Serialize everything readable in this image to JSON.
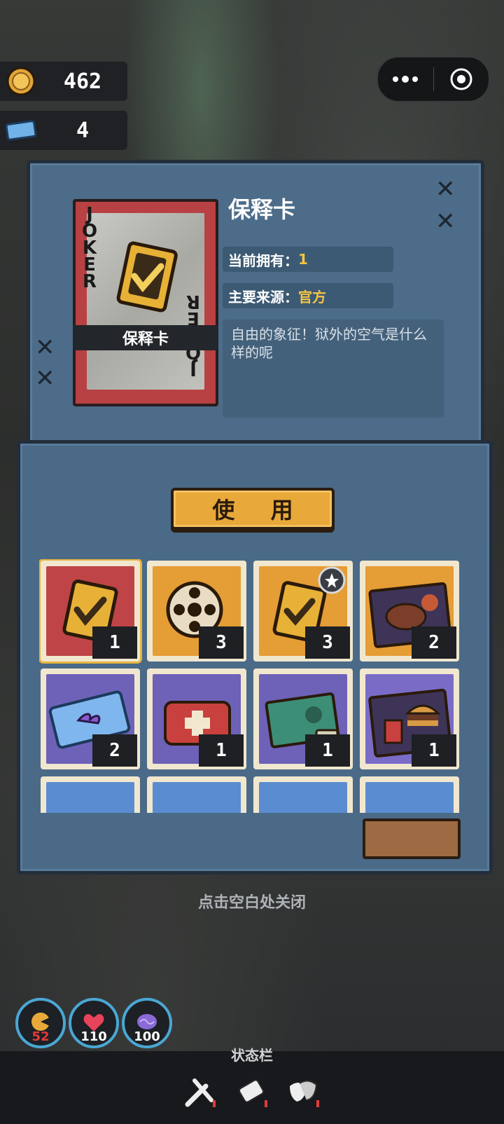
{
  "currencies": [
    {
      "icon": "coin-icon",
      "value": "462"
    },
    {
      "icon": "ticket-icon",
      "value": "4"
    }
  ],
  "capsule": {
    "menu_icon": "more-dots-icon",
    "close_icon": "target-icon"
  },
  "item": {
    "name": "保释卡",
    "card_title": "保释卡",
    "joker_text": "JOKER",
    "owned_label": "当前拥有：",
    "owned_value": "1",
    "source_label": "主要来源：",
    "source_value": "官方",
    "description": "自由的象征！狱外的空气是什么样的呢"
  },
  "use_button": "使 用",
  "inventory": [
    {
      "name": "bail-card",
      "color": "red",
      "count": "1",
      "selected": true
    },
    {
      "name": "film-reel",
      "color": "orange",
      "count": "3"
    },
    {
      "name": "bail-card-plus",
      "color": "orange",
      "count": "3"
    },
    {
      "name": "steak-meal",
      "color": "orange",
      "count": "2"
    },
    {
      "name": "toy-ticket",
      "color": "purple",
      "count": "2"
    },
    {
      "name": "first-aid-kit",
      "color": "purple",
      "count": "1"
    },
    {
      "name": "game-box",
      "color": "purple",
      "count": "1"
    },
    {
      "name": "burger-meal",
      "color": "purple",
      "count": "1"
    },
    {
      "name": "item-9",
      "color": "blue",
      "count": ""
    },
    {
      "name": "item-10",
      "color": "blue",
      "count": ""
    },
    {
      "name": "item-11",
      "color": "blue",
      "count": ""
    },
    {
      "name": "item-12",
      "color": "blue",
      "count": ""
    }
  ],
  "close_hint": "点击空白处关闭",
  "stats": [
    {
      "icon": "hunger-icon",
      "value": "52",
      "color": "#e23b3b"
    },
    {
      "icon": "heart-icon",
      "value": "110",
      "color": "#ffffff"
    },
    {
      "icon": "brain-icon",
      "value": "100",
      "color": "#ffffff"
    }
  ],
  "statusbar": {
    "label": "状态栏",
    "tools": [
      "tools-icon",
      "bandage-icon",
      "mask-icon"
    ]
  }
}
